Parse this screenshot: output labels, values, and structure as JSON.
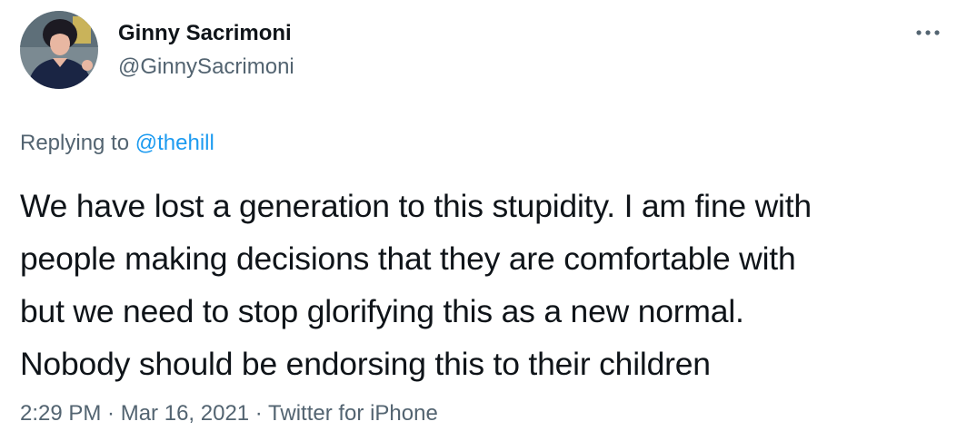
{
  "user": {
    "display_name": "Ginny Sacrimoni",
    "handle": "@GinnySacrimoni"
  },
  "reply": {
    "prefix": "Replying to ",
    "mention": "@thehill"
  },
  "tweet": {
    "lines": [
      "We have lost a generation to this stupidity. I am fine with",
      "people making decisions that they are comfortable with",
      "but we need to stop glorifying this as a new normal.",
      "Nobody should be endorsing this to their children"
    ]
  },
  "meta": {
    "time": "2:29 PM",
    "separator": " · ",
    "date": "Mar 16, 2021",
    "source": "Twitter for iPhone"
  },
  "icons": {
    "more": "more-options-icon"
  },
  "colors": {
    "text": "#0f1419",
    "secondary": "#536471",
    "link": "#1d9bf0"
  }
}
